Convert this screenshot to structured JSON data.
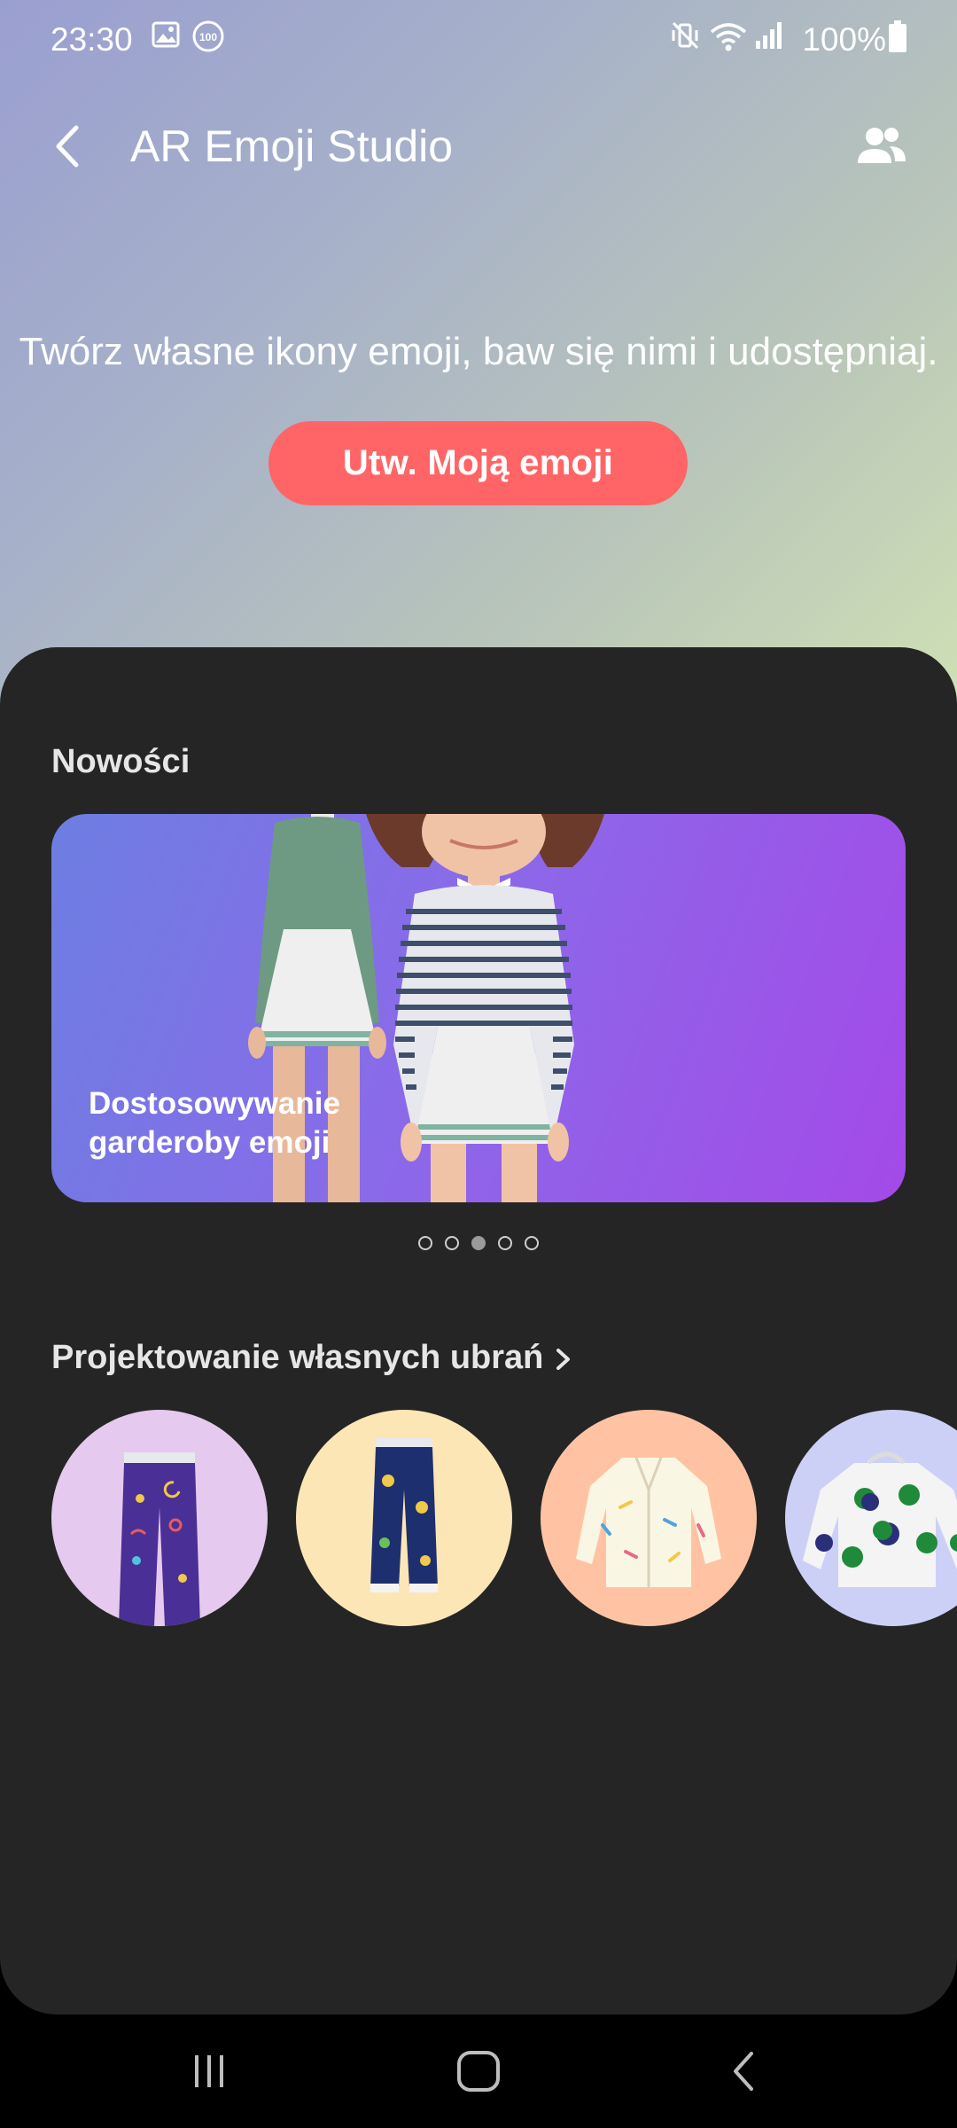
{
  "status_bar": {
    "time": "23:30",
    "battery": "100%",
    "icons": [
      "image-icon",
      "notification-100-icon",
      "mute-vibrate-icon",
      "wifi-icon",
      "signal-icon",
      "battery-icon"
    ]
  },
  "app_bar": {
    "title": "AR Emoji Studio",
    "back_icon": "back-arrow-icon",
    "people_icon": "people-icon"
  },
  "hero": {
    "text": "Twórz własne ikony emoji, baw się nimi i udostępniaj.",
    "cta_label": "Utw. Moją emoji",
    "cta_color": "#ff6566"
  },
  "news": {
    "title": "Nowości",
    "banner_caption": "Dostosowywanie garderoby emoji",
    "page_count": 5,
    "active_page": 3
  },
  "design": {
    "title": "Projektowanie własnych ubrań",
    "items": [
      {
        "name": "purple-pants",
        "bg": "#e6c9ee"
      },
      {
        "name": "navy-floral-pants",
        "bg": "#fde6b6"
      },
      {
        "name": "cream-jacket",
        "bg": "#ffc3a4"
      },
      {
        "name": "polka-hoodie",
        "bg": "#cdd0f6"
      }
    ]
  },
  "colors": {
    "sheet_bg": "#252525",
    "accent": "#ff6566"
  },
  "nav_bar": {
    "icons": [
      "recents-icon",
      "home-icon",
      "back-icon"
    ]
  }
}
